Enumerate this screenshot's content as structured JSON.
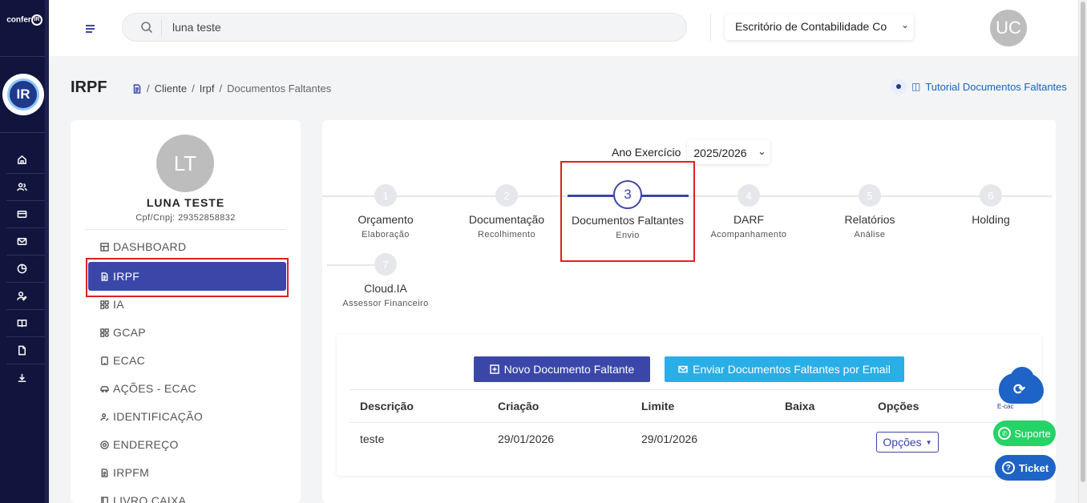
{
  "app": {
    "logo_text": "confer",
    "logo_mark": "IR"
  },
  "header": {
    "search_value": "luna teste",
    "office_select": "Escritório de Contabilidade Co",
    "user_initials": "UC"
  },
  "page": {
    "title": "IRPF",
    "breadcrumb": [
      "Cliente",
      "Irpf",
      "Documentos Faltantes"
    ],
    "breadcrumb_sep": "/",
    "tutorial_link": "Tutorial Documentos Faltantes"
  },
  "client": {
    "initials": "LT",
    "name": "LUNA TESTE",
    "cpf": "Cpf/Cnpj: 29352858832"
  },
  "menu": [
    {
      "label": "DASHBOARD",
      "icon": "dashboard-icon"
    },
    {
      "label": "IRPF",
      "icon": "document-icon"
    },
    {
      "label": "IA",
      "icon": "grid-icon"
    },
    {
      "label": "GCAP",
      "icon": "grid-icon"
    },
    {
      "label": "ECAC",
      "icon": "tablet-icon"
    },
    {
      "label": "AÇÕES - ECAC",
      "icon": "car-icon"
    },
    {
      "label": "IDENTIFICAÇÃO",
      "icon": "user-edit-icon"
    },
    {
      "label": "ENDEREÇO",
      "icon": "location-icon"
    },
    {
      "label": "IRPFM",
      "icon": "document-icon"
    },
    {
      "label": "LIVRO CAIXA",
      "icon": "book-icon"
    }
  ],
  "year": {
    "label": "Ano Exercício",
    "value": "2025/2026"
  },
  "steps": [
    {
      "num": "1",
      "label": "Orçamento",
      "sub": "Elaboração"
    },
    {
      "num": "2",
      "label": "Documentação",
      "sub": "Recolhimento"
    },
    {
      "num": "3",
      "label": "Documentos Faltantes",
      "sub": "Envio"
    },
    {
      "num": "4",
      "label": "DARF",
      "sub": "Acompanhamento"
    },
    {
      "num": "5",
      "label": "Relatórios",
      "sub": "Análise"
    },
    {
      "num": "6",
      "label": "Holding",
      "sub": ""
    },
    {
      "num": "7",
      "label": "Cloud.IA",
      "sub": "Assessor Financeiro"
    }
  ],
  "actions": {
    "new_doc": "Novo Documento Faltante",
    "send_email": "Enviar Documentos Faltantes por Email"
  },
  "table": {
    "headers": [
      "Descrição",
      "Criação",
      "Limite",
      "Baixa",
      "Opções"
    ],
    "rows": [
      {
        "descricao": "teste",
        "criacao": "29/01/2026",
        "limite": "29/01/2026",
        "baixa": "",
        "opcoes": "Opções"
      }
    ]
  },
  "widgets": {
    "ecac_label": "E-cac",
    "suporte": "Suporte",
    "ticket": "Ticket"
  },
  "colors": {
    "rail": "#11153d",
    "primary": "#3b47a8",
    "accent": "#29aee6",
    "highlight": "#e02020"
  }
}
